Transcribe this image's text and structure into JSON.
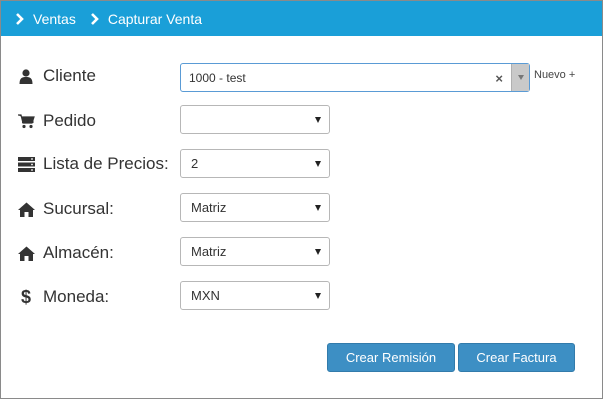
{
  "breadcrumb": {
    "items": [
      "Ventas",
      "Capturar Venta"
    ]
  },
  "form": {
    "cliente": {
      "label": "Cliente",
      "value": "1000 - test",
      "nuevo": "Nuevo +"
    },
    "pedido": {
      "label": "Pedido",
      "value": ""
    },
    "lista_precios": {
      "label": "Lista de Precios:",
      "value": "2"
    },
    "sucursal": {
      "label": "Sucursal:",
      "value": "Matriz"
    },
    "almacen": {
      "label": "Almacén:",
      "value": "Matriz"
    },
    "moneda": {
      "label": "Moneda:",
      "value": "MXN",
      "symbol": "$"
    }
  },
  "actions": {
    "crear_remision": "Crear Remisión",
    "crear_factura": "Crear Factura"
  },
  "icons": {
    "cliente": "user-icon",
    "pedido": "cart-icon",
    "lista_precios": "server-icon",
    "sucursal": "home-icon",
    "almacen": "home-icon",
    "moneda": "dollar-icon"
  },
  "colors": {
    "header": "#1a9fd8",
    "button": "#3d8fc4"
  }
}
